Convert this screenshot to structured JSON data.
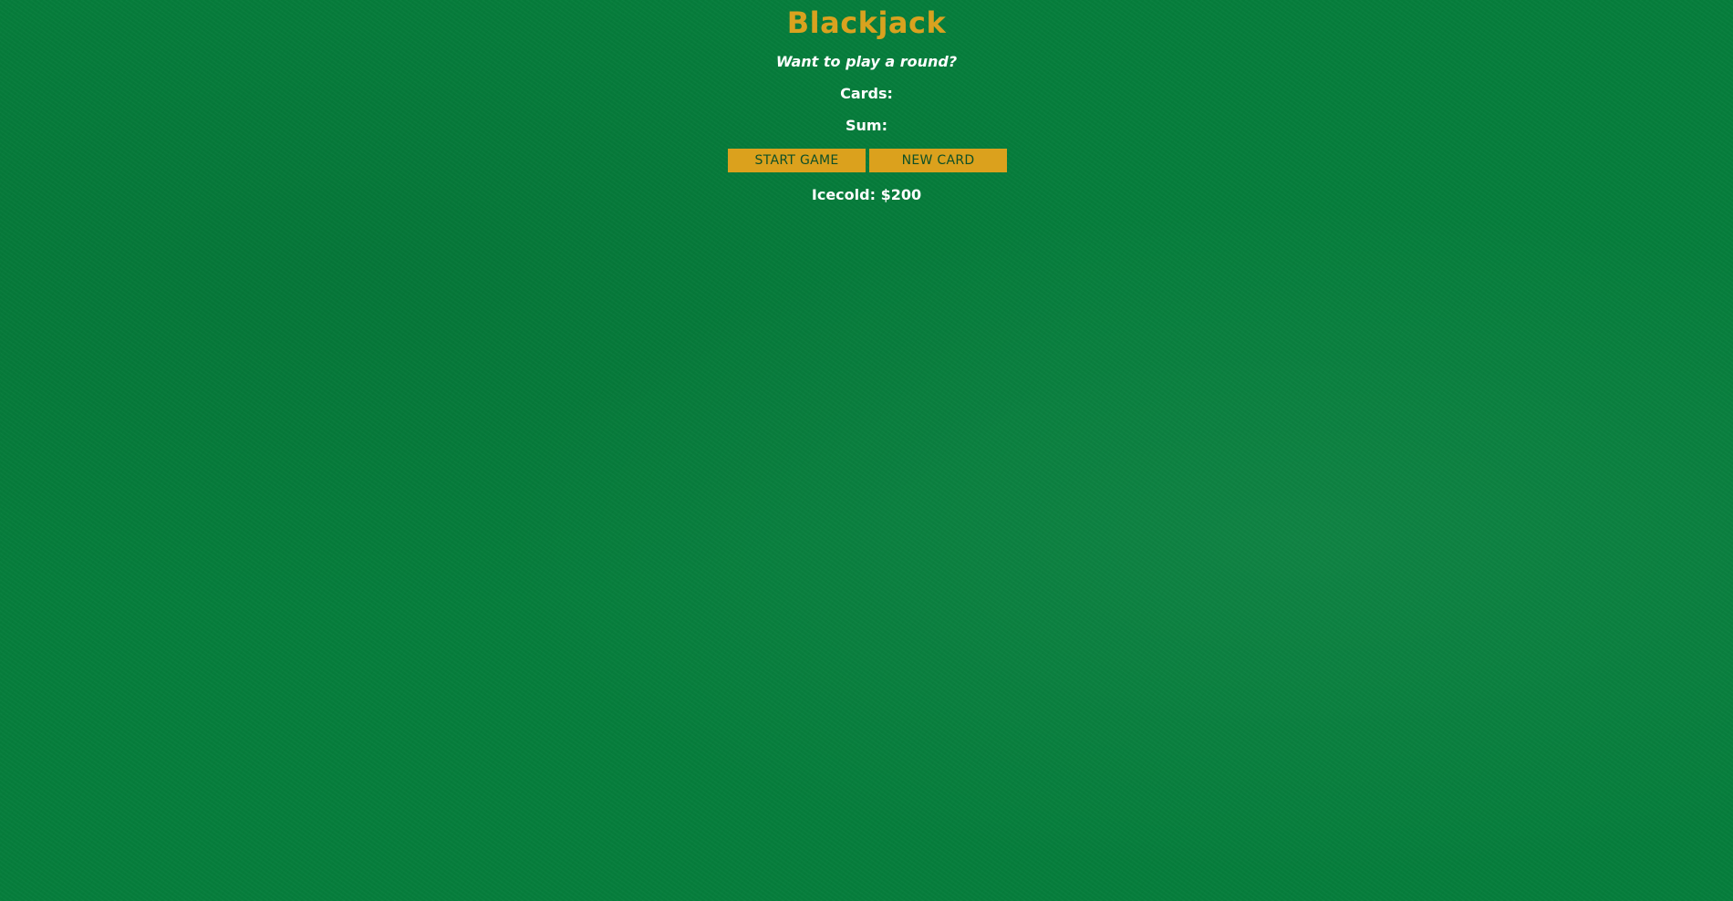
{
  "app": {
    "title": "Blackjack",
    "message": "Want to play a round?",
    "cards_label": "Cards:",
    "sum_label": "Sum:",
    "player_text": "Icecold: $200"
  },
  "buttons": {
    "start_label": "START GAME",
    "new_card_label": "NEW CARD"
  },
  "colors": {
    "background": "#067e3c",
    "accent": "#d9a21f",
    "button_text": "#0d4f27",
    "text": "#ffffff"
  }
}
